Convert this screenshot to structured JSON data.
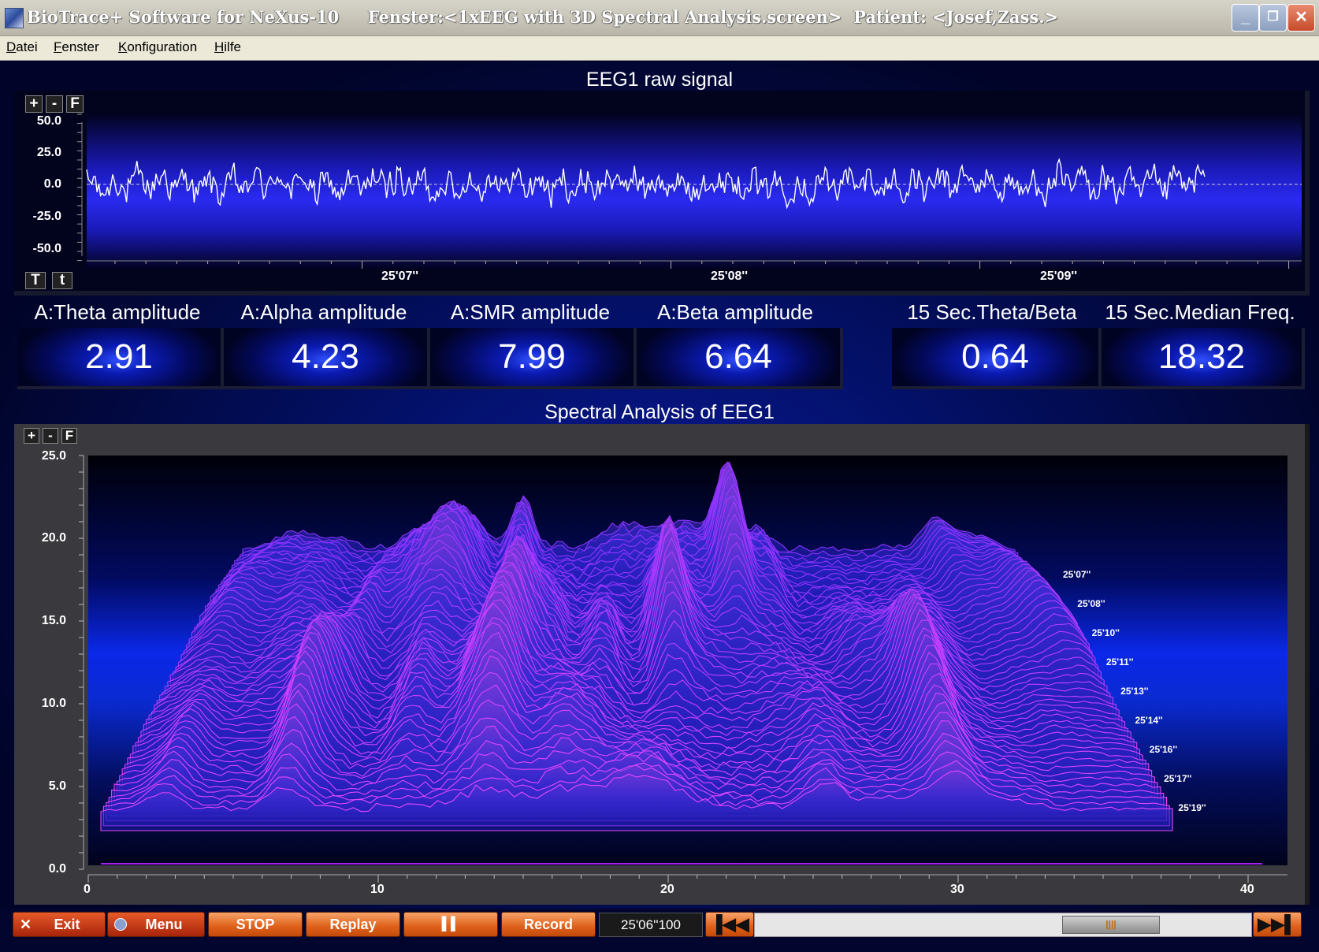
{
  "window": {
    "title": "BioTrace+ Software for NeXus-10     Fenster:<1xEEG with 3D Spectral Analysis.screen>  Patient: <Josef,Zass.>",
    "buttons": {
      "minimize": "_",
      "restore": "❐",
      "close": "✕"
    }
  },
  "menu": [
    "Datei",
    "Fenster",
    "Konfiguration",
    "Hilfe"
  ],
  "raw": {
    "title": "EEG1 raw signal",
    "zoom": [
      "+",
      "-",
      "F"
    ],
    "time_buttons": [
      "T",
      "t"
    ],
    "yticks": [
      "50.0",
      "25.0",
      "0.0",
      "-25.0",
      "-50.0"
    ],
    "xticks": [
      "25'07''",
      "25'08''",
      "25'09''"
    ]
  },
  "values": [
    {
      "label": "A:Theta amplitude",
      "value": "2.91"
    },
    {
      "label": "A:Alpha amplitude",
      "value": "4.23"
    },
    {
      "label": "A:SMR amplitude",
      "value": "7.99"
    },
    {
      "label": "A:Beta amplitude",
      "value": "6.64"
    },
    {
      "label": "15 Sec.Theta/Beta",
      "value": "0.64"
    },
    {
      "label": "15 Sec.Median Freq.",
      "value": "18.32"
    }
  ],
  "spectral": {
    "title": "Spectral Analysis of EEG1",
    "zoom": [
      "+",
      "-",
      "F"
    ],
    "yticks": [
      "25.0",
      "20.0",
      "15.0",
      "10.0",
      "5.0",
      "0.0"
    ],
    "xticks": [
      "0",
      "10",
      "20",
      "30",
      "40"
    ],
    "time_labels": [
      "25'07''",
      "25'08''",
      "25'10''",
      "25'11''",
      "25'13''",
      "25'14''",
      "25'16''",
      "25'17''",
      "25'19''"
    ]
  },
  "toolbar": {
    "exit": "Exit",
    "menu": "Menu",
    "stop": "STOP",
    "replay": "Replay",
    "pause": "▌▌",
    "record": "Record",
    "time": "25'06''100",
    "rewind": "▐◀◀",
    "forward": "▶▶▌",
    "scroll_thumb": "||||"
  },
  "colors": {
    "accent": "#e0641e",
    "signal": "#ffffff",
    "spectrum": "#a020f0"
  }
}
